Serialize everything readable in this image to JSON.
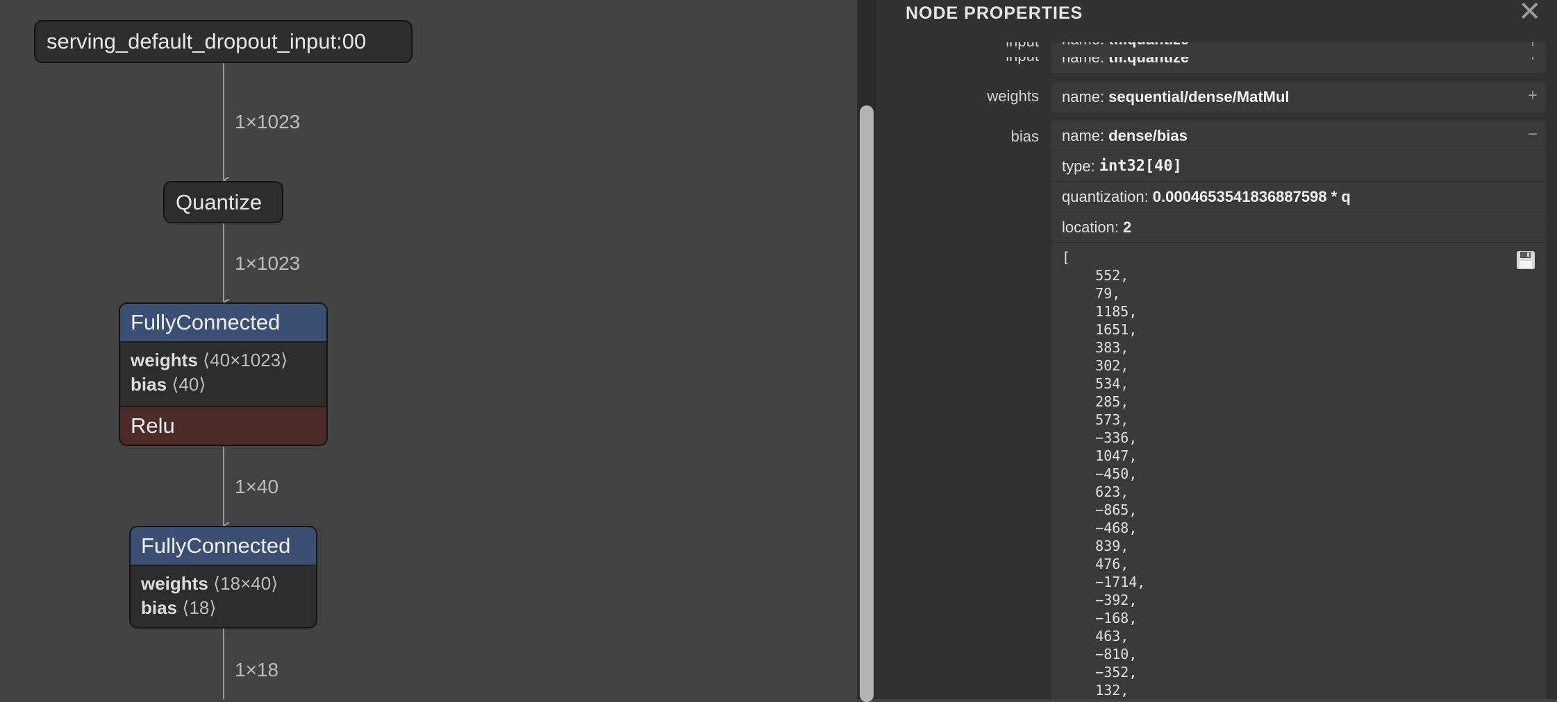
{
  "graph": {
    "input_node": "serving_default_dropout_input:00",
    "quantize_node": "Quantize",
    "fc1": {
      "title": "FullyConnected",
      "weights_label": "weights",
      "weights_shape": "⟨40×1023⟩",
      "bias_label": "bias",
      "bias_shape": "⟨40⟩",
      "activation": "Relu"
    },
    "fc2": {
      "title": "FullyConnected",
      "weights_label": "weights",
      "weights_shape": "⟨18×40⟩",
      "bias_label": "bias",
      "bias_shape": "⟨18⟩"
    },
    "edges": [
      "1×1023",
      "1×1023",
      "1×40",
      "1×18"
    ]
  },
  "sidebar": {
    "title": "NODE PROPERTIES",
    "close_icon": "close-icon",
    "input": {
      "label": "input",
      "prefix": "name:",
      "value": "tfl.quantize",
      "toggle": "+"
    },
    "weights": {
      "label": "weights",
      "prefix": "name:",
      "value": "sequential/dense/MatMul",
      "toggle": "+"
    },
    "bias": {
      "label": "bias",
      "toggle": "−",
      "name_prefix": "name:",
      "name": "dense/bias",
      "type_prefix": "type:",
      "type": "int32[40]",
      "quant_prefix": "quantization:",
      "quantization": "0.0004653541836887598 * q",
      "location_prefix": "location:",
      "location": "2",
      "values_text": "[\n    552,\n    79,\n    1185,\n    1651,\n    383,\n    302,\n    534,\n    285,\n    573,\n    −336,\n    1047,\n    −450,\n    623,\n    −865,\n    −468,\n    839,\n    476,\n    −1714,\n    −392,\n    −168,\n    463,\n    −810,\n    −352,\n    132,",
      "save_icon": "save-icon"
    }
  }
}
